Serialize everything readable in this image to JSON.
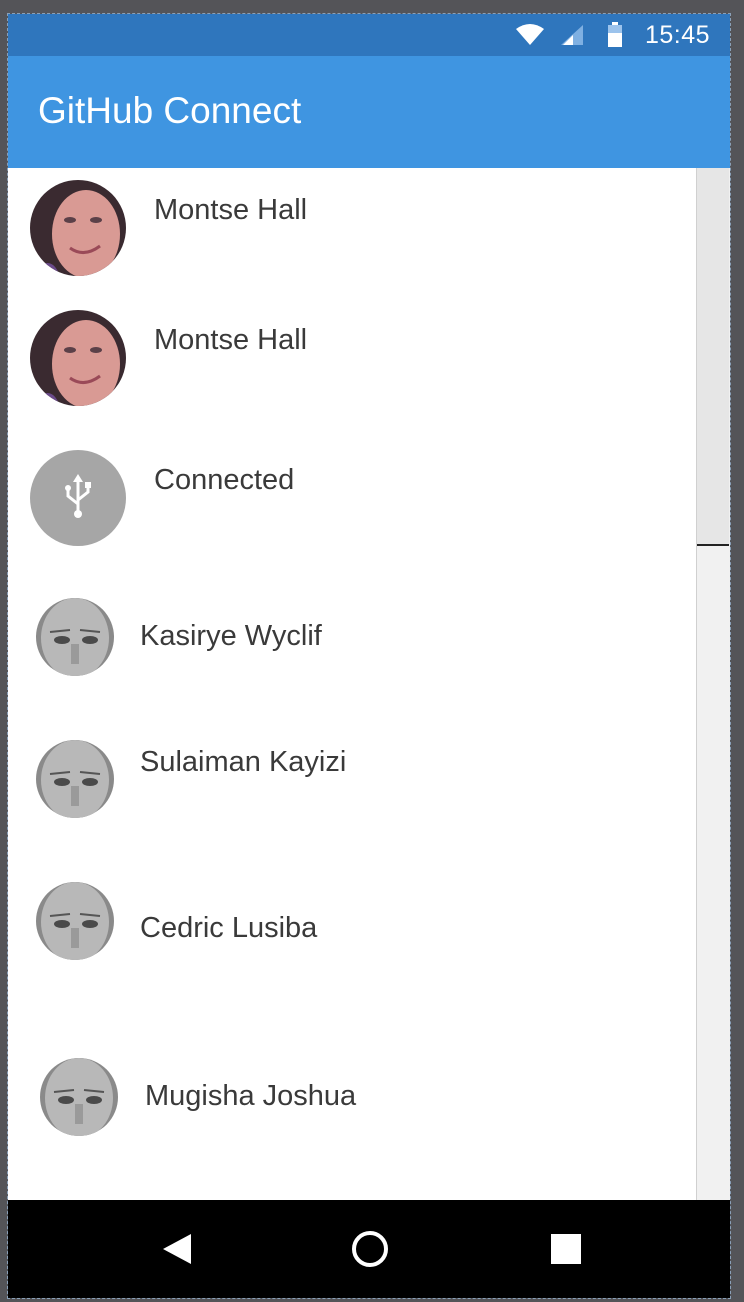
{
  "status_bar": {
    "time": "15:45",
    "icons": [
      "wifi-icon",
      "signal-icon",
      "battery-icon"
    ]
  },
  "app_bar": {
    "title": "GitHub Connect",
    "color": "#3f95e1",
    "status_color": "#2f76bd"
  },
  "list": {
    "items": [
      {
        "name": "Montse Hall",
        "avatar": "photo-woman"
      },
      {
        "name": "Montse Hall",
        "avatar": "photo-woman"
      },
      {
        "name": "Connected",
        "avatar": "usb-icon"
      },
      {
        "name": "Kasirye Wyclif",
        "avatar": "photo-man"
      },
      {
        "name": "Sulaiman Kayizi",
        "avatar": "photo-man"
      },
      {
        "name": "Cedric Lusiba",
        "avatar": "photo-man"
      },
      {
        "name": "Mugisha Joshua",
        "avatar": "photo-man"
      }
    ]
  },
  "nav_bar": {
    "buttons": [
      "back-icon",
      "home-icon",
      "recents-icon"
    ]
  }
}
